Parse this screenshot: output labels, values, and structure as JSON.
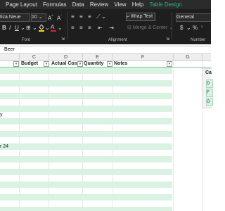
{
  "menu": {
    "items": [
      "Page Layout",
      "Formulas",
      "Data",
      "Review",
      "View",
      "Help",
      "Table Design"
    ]
  },
  "ribbon": {
    "font_name": "tica Neue",
    "font_size": "10",
    "wrap_text": "Wrap Text",
    "merge_center": "Merge & Center",
    "number_format": "General",
    "groups": {
      "font": "Font",
      "alignment": "Alignment",
      "number": "Number"
    },
    "icons": [
      "bold-icon",
      "italic-icon",
      "underline-icon",
      "borders-icon",
      "fill-color-icon",
      "font-color-icon",
      "align-top-icon",
      "align-middle-icon",
      "align-bottom-icon",
      "orientation-icon",
      "align-left-icon",
      "align-center-icon",
      "align-right-icon",
      "decrease-indent-icon",
      "increase-indent-icon",
      "currency-icon",
      "percent-icon"
    ],
    "fill_color": "#ffd400",
    "font_color": "#e02020"
  },
  "formula_bar": {
    "value": "Beer"
  },
  "columns": [
    "C",
    "D",
    "E",
    "F",
    "G"
  ],
  "table": {
    "headers": [
      "Budget",
      "Actual Cost",
      "Quantity",
      "Notes"
    ],
    "row_labels": [
      "",
      "",
      "",
      "",
      "",
      "",
      "",
      "y",
      "",
      "",
      "",
      "",
      "r 24",
      "",
      "",
      "",
      "",
      "",
      "",
      "",
      "",
      "",
      ""
    ],
    "stripe_color": "#d9f2e2"
  },
  "side_card": {
    "title": "Ca",
    "items": [
      "D",
      "F",
      "G"
    ]
  }
}
